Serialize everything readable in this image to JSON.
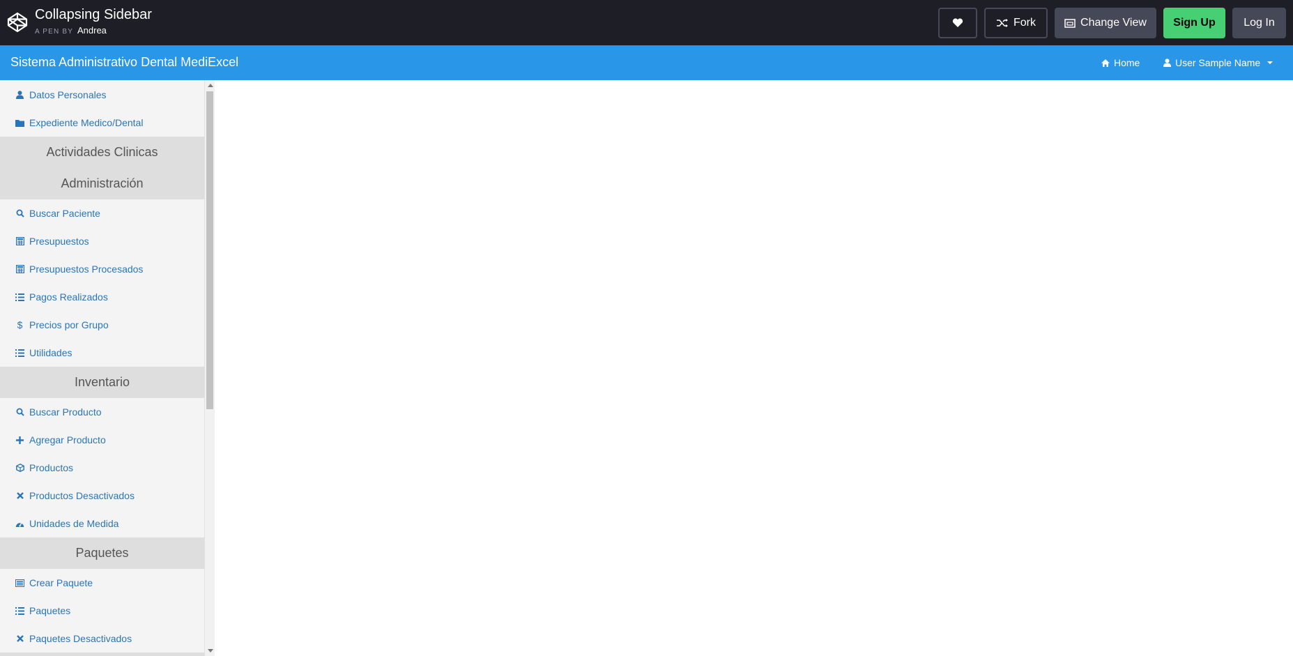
{
  "codepen": {
    "title": "Collapsing Sidebar",
    "by_label": "A PEN BY",
    "author": "Andrea",
    "buttons": {
      "fork": "Fork",
      "change_view": "Change View",
      "sign_up": "Sign Up",
      "log_in": "Log In"
    }
  },
  "navbar": {
    "brand": "Sistema Administrativo Dental MediExcel",
    "home": "Home",
    "user": "User Sample Name"
  },
  "sidebar": {
    "items_top": [
      {
        "label": "Datos Personales",
        "icon": "user-icon"
      },
      {
        "label": "Expediente Medico/Dental",
        "icon": "folder-icon"
      }
    ],
    "heading_actividades": "Actividades Clinicas",
    "heading_administracion": "Administración",
    "items_admin": [
      {
        "label": "Buscar Paciente",
        "icon": "search-icon"
      },
      {
        "label": "Presupuestos",
        "icon": "calculator-icon"
      },
      {
        "label": "Presupuestos Procesados",
        "icon": "calculator-icon"
      },
      {
        "label": "Pagos Realizados",
        "icon": "list-icon"
      },
      {
        "label": "Precios por Grupo",
        "icon": "dollar-icon"
      },
      {
        "label": "Utilidades",
        "icon": "list-icon"
      }
    ],
    "heading_inventario": "Inventario",
    "items_inventario": [
      {
        "label": "Buscar Producto",
        "icon": "search-icon"
      },
      {
        "label": "Agregar Producto",
        "icon": "plus-icon"
      },
      {
        "label": "Productos",
        "icon": "cube-icon"
      },
      {
        "label": "Productos Desactivados",
        "icon": "times-icon"
      },
      {
        "label": "Unidades de Medida",
        "icon": "dashboard-icon"
      }
    ],
    "heading_paquetes": "Paquetes",
    "items_paquetes": [
      {
        "label": "Crear Paquete",
        "icon": "tasks-icon"
      },
      {
        "label": "Paquetes",
        "icon": "list-icon"
      },
      {
        "label": "Paquetes Desactivados",
        "icon": "times-icon"
      }
    ]
  },
  "colors": {
    "codepen_bar": "#1e1f26",
    "navbar": "#2a96e8",
    "sidebar_bg": "#f4f4f4",
    "sidebar_heading_bg": "#dedede",
    "link": "#2a75b8",
    "signup": "#47cf73"
  }
}
